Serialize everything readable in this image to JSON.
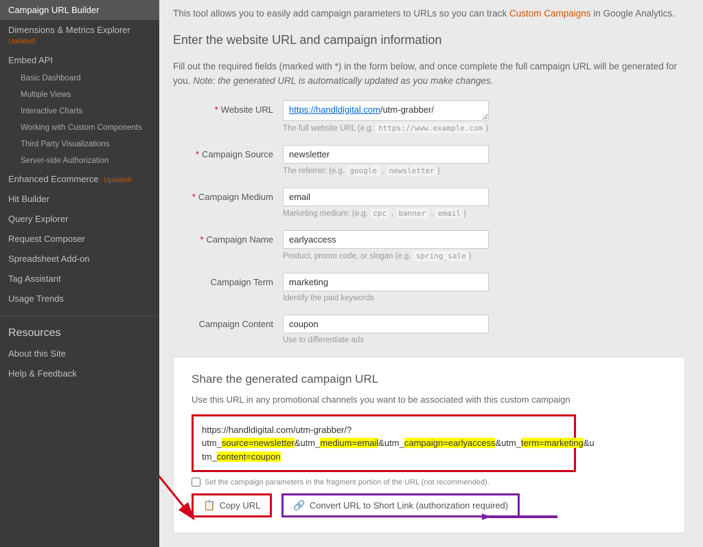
{
  "sidebar": {
    "active": "Campaign URL Builder",
    "items": [
      {
        "label": "Dimensions & Metrics Explorer",
        "badge": "Updated!"
      },
      {
        "label": "Embed API"
      },
      {
        "sub": true,
        "label": "Basic Dashboard"
      },
      {
        "sub": true,
        "label": "Multiple Views"
      },
      {
        "sub": true,
        "label": "Interactive Charts"
      },
      {
        "sub": true,
        "label": "Working with Custom Components"
      },
      {
        "sub": true,
        "label": "Third Party Visualizations"
      },
      {
        "sub": true,
        "label": "Server-side Authorization"
      },
      {
        "label": "Enhanced Ecommerce",
        "badge_inline": "Updated!"
      },
      {
        "label": "Hit Builder"
      },
      {
        "label": "Query Explorer"
      },
      {
        "label": "Request Composer"
      },
      {
        "label": "Spreadsheet Add-on"
      },
      {
        "label": "Tag Assistant"
      },
      {
        "label": "Usage Trends"
      }
    ],
    "resources_heading": "Resources",
    "resources": [
      {
        "label": "About this Site"
      },
      {
        "label": "Help & Feedback"
      }
    ]
  },
  "intro": {
    "pre": "This tool allows you to easily add campaign parameters to URLs so you can track ",
    "link": "Custom Campaigns",
    "post": " in Google Analytics."
  },
  "heading": "Enter the website URL and campaign information",
  "sub_intro": {
    "text": "Fill out the required fields (marked with *) in the form below, and once complete the full campaign URL will be generated for you. ",
    "note": "Note: the generated URL is automatically updated as you make changes."
  },
  "form": {
    "website_url": {
      "label": "Website URL",
      "required": true,
      "value_pre": "https://handldigital.com",
      "value_post": "/utm-grabber/",
      "hint_pre": "The full website URL (e.g. ",
      "hint_code": "https://www.example.com",
      "hint_post": ")"
    },
    "source": {
      "label": "Campaign Source",
      "required": true,
      "value": "newsletter",
      "hint_pre": "The referrer: (e.g. ",
      "hint_codes": [
        "google",
        "newsletter"
      ],
      "hint_post": ")"
    },
    "medium": {
      "label": "Campaign Medium",
      "required": true,
      "value": "email",
      "hint_pre": "Marketing medium: (e.g. ",
      "hint_codes": [
        "cpc",
        "banner",
        "email"
      ],
      "hint_post": ")"
    },
    "name": {
      "label": "Campaign Name",
      "required": true,
      "value": "earlyaccess",
      "hint_pre": "Product, promo code, or slogan (e.g. ",
      "hint_codes": [
        "spring_sale"
      ],
      "hint_post": ")"
    },
    "term": {
      "label": "Campaign Term",
      "required": false,
      "value": "marketing",
      "hint": "Identify the paid keywords"
    },
    "content": {
      "label": "Campaign Content",
      "required": false,
      "value": "coupon",
      "hint": "Use to differentiate ads"
    }
  },
  "share": {
    "title": "Share the generated campaign URL",
    "desc": "Use this URL in any promotional channels you want to be associated with this custom campaign",
    "url_parts": {
      "p0": "https://handldigital.com/utm-grabber/?",
      "p1": "utm_",
      "h1": "source=newsletter",
      "s1": "&utm_",
      "h2": "medium=email",
      "s2": "&utm_",
      "h3": "campaign=earlyaccess",
      "s3": "&utm_",
      "h4": "term=marketing",
      "s4": "&u",
      "p2": "tm_",
      "h5": "content=coupon"
    },
    "checkbox_label": "Set the campaign parameters in the fragment portion of the URL (not recommended).",
    "copy_btn": "Copy URL",
    "convert_btn": "Convert URL to Short Link (authorization required)"
  }
}
